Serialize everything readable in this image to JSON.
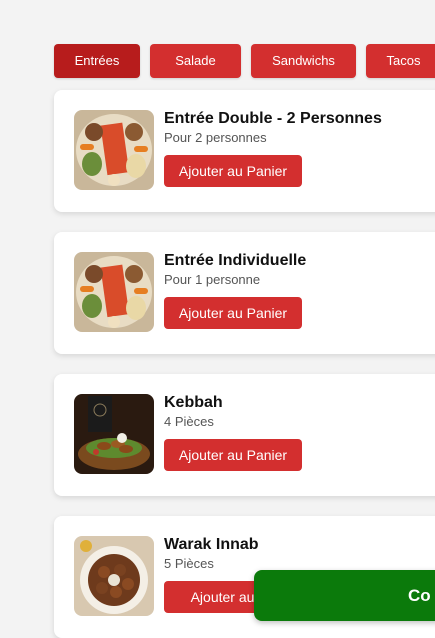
{
  "tabs": [
    {
      "label": "Entrées"
    },
    {
      "label": "Salade"
    },
    {
      "label": "Sandwichs"
    },
    {
      "label": "Tacos"
    }
  ],
  "items": [
    {
      "title": "Entrée Double - 2 Personnes",
      "subtitle": "Pour 2 personnes",
      "button": "Ajouter au Panier",
      "image": "platter-image"
    },
    {
      "title": "Entrée Individuelle",
      "subtitle": "Pour 1 personne",
      "button": "Ajouter au Panier",
      "image": "platter-image"
    },
    {
      "title": "Kebbah",
      "subtitle": "4 Pièces",
      "button": "Ajouter au Panier",
      "image": "kebbah-image"
    },
    {
      "title": "Warak Innab",
      "subtitle": "5 Pièces",
      "button": "Ajouter au Pa",
      "image": "warak-innab-image"
    }
  ],
  "cart_bar": {
    "label": "Co"
  },
  "colors": {
    "primary": "#d32f2f",
    "primary_active": "#b71c1c",
    "cart": "#0b7a0b",
    "background": "#f3f3f3"
  }
}
